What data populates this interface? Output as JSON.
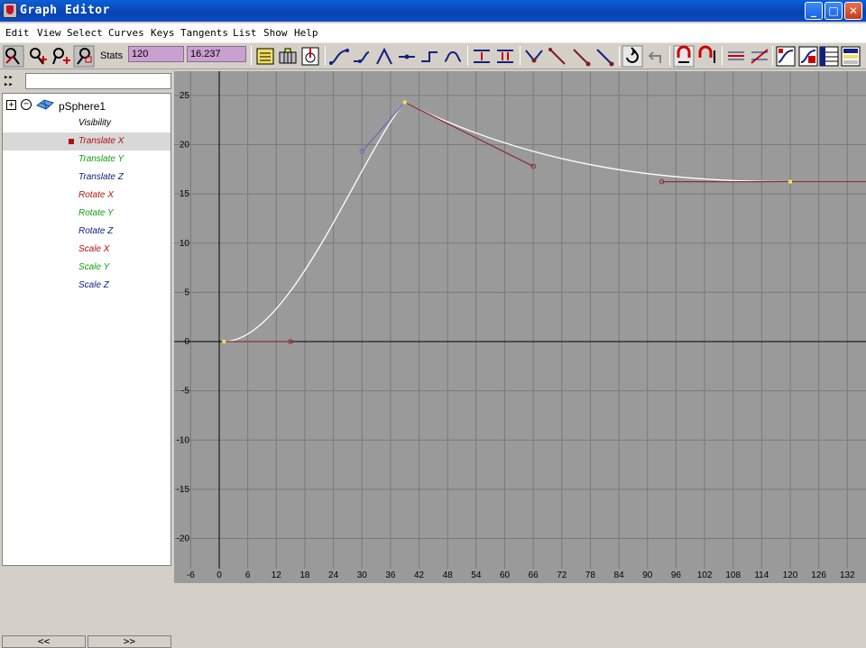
{
  "window": {
    "title": "Graph Editor"
  },
  "title_buttons": {
    "minimize": "_",
    "maximize": "□",
    "close": "✕"
  },
  "menu": [
    "Edit",
    "View",
    "Select",
    "Curves",
    "Keys",
    "Tangents",
    "List",
    "Show",
    "Help"
  ],
  "stats": {
    "label": "Stats",
    "frame": "120",
    "value": "16.237"
  },
  "outliner": {
    "root": "pSphere1",
    "expand": "+",
    "collapse": "−",
    "channels": [
      {
        "label": "Visibility",
        "color": "#000000"
      },
      {
        "label": "Translate X",
        "color": "#b01010"
      },
      {
        "label": "Translate Y",
        "color": "#10a010"
      },
      {
        "label": "Translate Z",
        "color": "#102080"
      },
      {
        "label": "Rotate X",
        "color": "#b01010"
      },
      {
        "label": "Rotate Y",
        "color": "#10a010"
      },
      {
        "label": "Rotate Z",
        "color": "#102080"
      },
      {
        "label": "Scale X",
        "color": "#b01010"
      },
      {
        "label": "Scale Y",
        "color": "#10a010"
      },
      {
        "label": "Scale Z",
        "color": "#102080"
      }
    ],
    "selected_index": 1,
    "scroll_left": "<<",
    "scroll_right": ">>"
  },
  "graph": {
    "x_ticks": [
      "-6",
      "0",
      "6",
      "12",
      "18",
      "24",
      "30",
      "36",
      "42",
      "48",
      "54",
      "60",
      "66",
      "72",
      "78",
      "84",
      "90",
      "96",
      "102",
      "108",
      "114",
      "120",
      "126",
      "132"
    ],
    "y_ticks": [
      "25",
      "20",
      "15",
      "10",
      "5",
      "0",
      "-5",
      "-10",
      "-15",
      "-20"
    ],
    "x_range": [
      -6,
      132
    ],
    "y_range": [
      -20,
      25
    ],
    "curve_color": "#ffffff",
    "tangent_color": "#8a3030",
    "in_tangent_color": "#6a70b8",
    "key_color": "#f0e060",
    "background": "#9a9a9a",
    "grid_color": "#7a7a7a",
    "axis_color": "#000000",
    "keys": [
      {
        "frame": 1,
        "value": 0,
        "out_handle": [
          15,
          0
        ]
      },
      {
        "frame": 39,
        "value": 24.3,
        "in_handle": [
          30,
          19.3
        ],
        "out_handle": [
          66,
          17.8
        ]
      },
      {
        "frame": 120,
        "value": 16.237,
        "in_handle": [
          93,
          16.237
        ],
        "out_handle": [
          138,
          16.237
        ]
      }
    ]
  }
}
